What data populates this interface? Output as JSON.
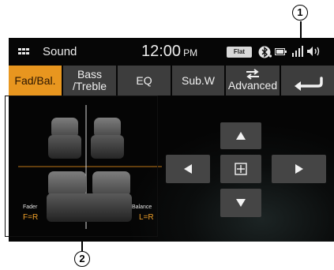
{
  "header": {
    "title": "Sound",
    "time": "12:00",
    "ampm": "PM",
    "eq_badge": "Flat"
  },
  "tabs": [
    {
      "label": "Fad/Bal.",
      "active": true
    },
    {
      "label": "Bass /Treble",
      "line1": "Bass",
      "line2": "/Treble",
      "active": false
    },
    {
      "label": "EQ",
      "active": false
    },
    {
      "label": "Sub.W",
      "active": false
    },
    {
      "label": "Advanced",
      "active": false
    }
  ],
  "diagram": {
    "fader_label": "Fader",
    "fader_value": "F=R",
    "balance_label": "Balance",
    "balance_value": "L=R"
  },
  "callouts": {
    "one": "1",
    "two": "2"
  },
  "colors": {
    "accent": "#e8961f",
    "button": "#3d3d3d",
    "background": "#060606"
  },
  "icons": [
    "apps-grid-icon",
    "bluetooth-icon",
    "battery-icon",
    "signal-icon",
    "volume-icon",
    "back-icon",
    "up-arrow-icon",
    "down-arrow-icon",
    "left-arrow-icon",
    "right-arrow-icon",
    "center-icon",
    "swap-arrows-icon"
  ]
}
